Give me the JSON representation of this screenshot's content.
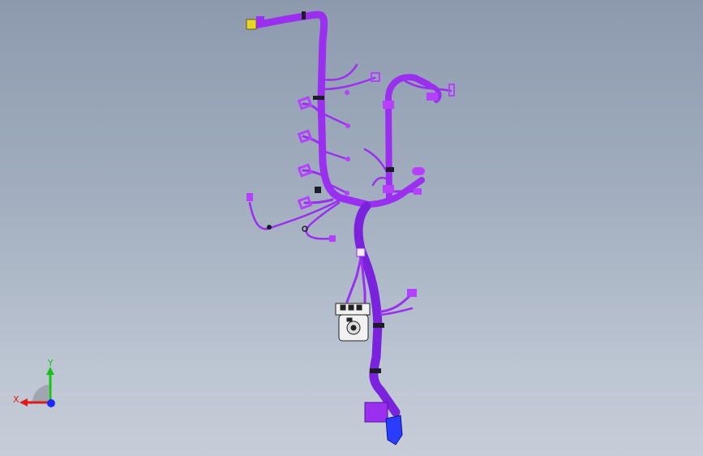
{
  "viewport": {
    "background_top": "#8d9aae",
    "background_bottom": "#c6cdd8"
  },
  "model": {
    "harness_color": "#9a2ff0",
    "harness_dark": "#6a16c8",
    "connector_color": "#b640ff",
    "end_connector_color": "#2a3cff",
    "clip_color": "#1c1c2a",
    "yellow_connector": "#e5d62a"
  },
  "triad": {
    "x_label": "X",
    "y_label": "Y",
    "x_color": "#e01818",
    "y_color": "#18c218",
    "z_color": "#1a2aff"
  }
}
